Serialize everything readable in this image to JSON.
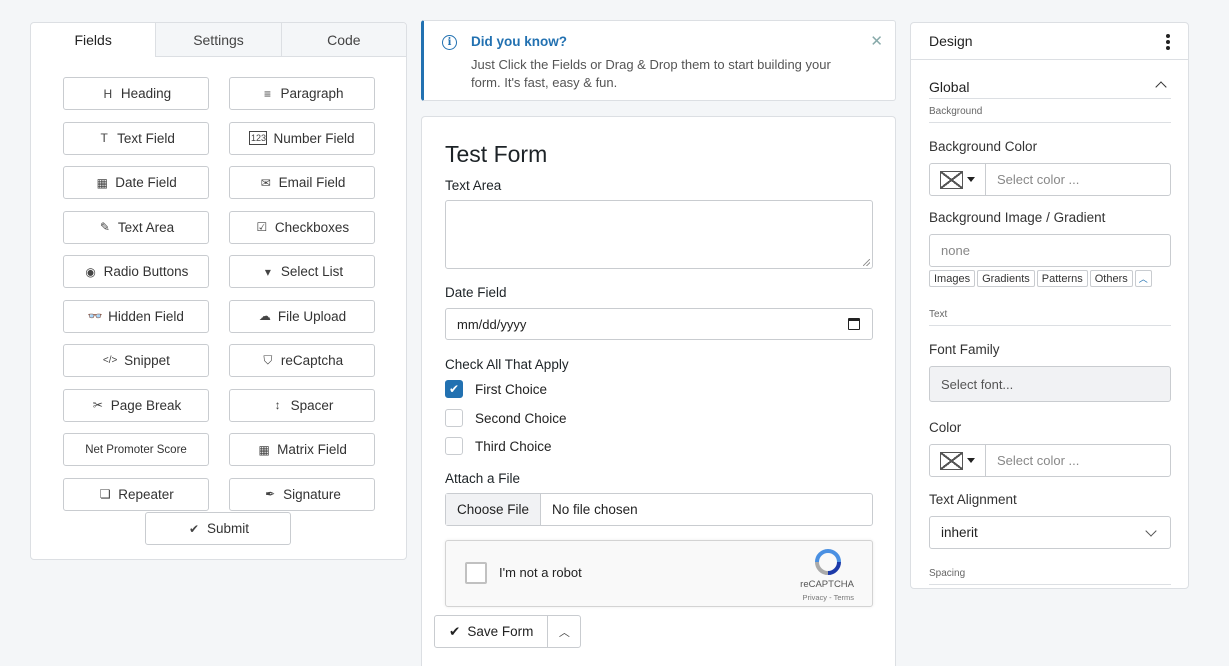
{
  "left_panel": {
    "tabs": [
      {
        "label": "Fields",
        "active": true
      },
      {
        "label": "Settings",
        "active": false
      },
      {
        "label": "Code",
        "active": false
      }
    ],
    "fields": [
      {
        "label": "Heading",
        "icon": "heading-icon",
        "glyph": "H"
      },
      {
        "label": "Paragraph",
        "icon": "paragraph-icon",
        "glyph": "≡"
      },
      {
        "label": "Text Field",
        "icon": "text-field-icon",
        "glyph": "T"
      },
      {
        "label": "Number Field",
        "icon": "number-field-icon",
        "glyph": "123"
      },
      {
        "label": "Date Field",
        "icon": "calendar-icon",
        "glyph": "▦"
      },
      {
        "label": "Email Field",
        "icon": "envelope-icon",
        "glyph": "✉"
      },
      {
        "label": "Text Area",
        "icon": "edit-icon",
        "glyph": "✎"
      },
      {
        "label": "Checkboxes",
        "icon": "checkbox-icon",
        "glyph": "☑"
      },
      {
        "label": "Radio Buttons",
        "icon": "radio-icon",
        "glyph": "◉"
      },
      {
        "label": "Select List",
        "icon": "select-icon",
        "glyph": "▾"
      },
      {
        "label": "Hidden Field",
        "icon": "glasses-icon",
        "glyph": "👓"
      },
      {
        "label": "File Upload",
        "icon": "cloud-upload-icon",
        "glyph": "☁"
      },
      {
        "label": "Snippet",
        "icon": "code-icon",
        "glyph": "</>"
      },
      {
        "label": "reCaptcha",
        "icon": "shield-icon",
        "glyph": "⛉"
      },
      {
        "label": "Page Break",
        "icon": "scissors-icon",
        "glyph": "✂"
      },
      {
        "label": "Spacer",
        "icon": "arrows-vertical-icon",
        "glyph": "↕"
      },
      {
        "label": "Net Promoter Score",
        "icon": "",
        "glyph": ""
      },
      {
        "label": "Matrix Field",
        "icon": "table-icon",
        "glyph": "▦"
      },
      {
        "label": "Repeater",
        "icon": "layers-icon",
        "glyph": "❏"
      },
      {
        "label": "Signature",
        "icon": "pen-icon",
        "glyph": "✒"
      }
    ],
    "submit_label": "Submit"
  },
  "notice": {
    "title": "Did you know?",
    "text": "Just Click the Fields or Drag & Drop them to start building your form. It's fast, easy & fun."
  },
  "form": {
    "title": "Test Form",
    "text_area_label": "Text Area",
    "date_label": "Date Field",
    "date_placeholder": "mm/dd/yyyy",
    "checkbox_label": "Check All That Apply",
    "choices": [
      {
        "label": "First Choice",
        "checked": true
      },
      {
        "label": "Second Choice",
        "checked": false
      },
      {
        "label": "Third Choice",
        "checked": false
      }
    ],
    "file_label": "Attach a File",
    "choose_file": "Choose File",
    "no_file": "No file chosen",
    "captcha_text": "I'm not a robot",
    "captcha_brand": "reCAPTCHA",
    "captcha_terms": "Privacy - Terms",
    "save_label": "Save Form"
  },
  "design": {
    "title": "Design",
    "global_label": "Global",
    "background_sub": "Background",
    "bg_color_label": "Background Color",
    "bg_color_placeholder": "Select color ...",
    "bg_image_label": "Background Image / Gradient",
    "bg_image_value": "none",
    "bg_chips": [
      "Images",
      "Gradients",
      "Patterns",
      "Others"
    ],
    "text_sub": "Text",
    "font_family_label": "Font Family",
    "font_placeholder": "Select font...",
    "color_label": "Color",
    "color_placeholder": "Select color ...",
    "alignment_label": "Text Alignment",
    "alignment_value": "inherit",
    "spacing_sub": "Spacing"
  },
  "colors": {
    "accent": "#2271b1",
    "border": "#c9ccd0",
    "page_bg": "#f4f6f8"
  }
}
